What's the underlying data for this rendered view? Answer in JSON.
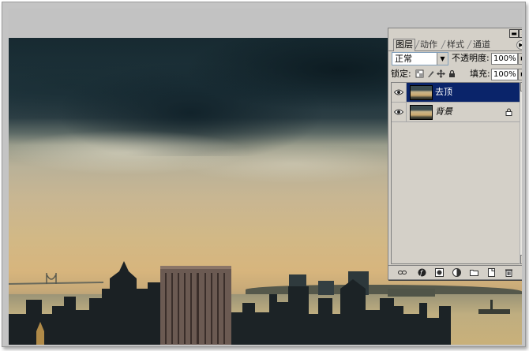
{
  "layers_panel": {
    "tabs": [
      {
        "label": "图层",
        "active": true
      },
      {
        "label": "动作",
        "active": false
      },
      {
        "label": "样式",
        "active": false
      },
      {
        "label": "通道",
        "active": false
      }
    ],
    "blend_mode": "正常",
    "opacity_label": "不透明度:",
    "opacity_value": "100%",
    "lock_label": "锁定:",
    "fill_label": "填充:",
    "fill_value": "100%",
    "layers": [
      {
        "name": "去顶",
        "selected": true,
        "visible": true,
        "locked": false
      },
      {
        "name": "背景",
        "selected": false,
        "visible": true,
        "locked": true
      }
    ]
  },
  "icons": {
    "titlebar": [
      "minimize-icon",
      "close-icon"
    ],
    "lock_options": [
      "lock-transparent-icon",
      "lock-paint-icon",
      "lock-move-icon",
      "lock-all-icon"
    ],
    "bottom_bar": [
      "link-icon",
      "layer-style-icon",
      "mask-icon",
      "adjustment-layer-icon",
      "new-group-icon",
      "new-layer-icon",
      "trash-icon"
    ]
  },
  "colors": {
    "selection": "#0a246a",
    "panel_bg": "#d4d0c8",
    "workspace_bg": "#c2c2c2"
  }
}
